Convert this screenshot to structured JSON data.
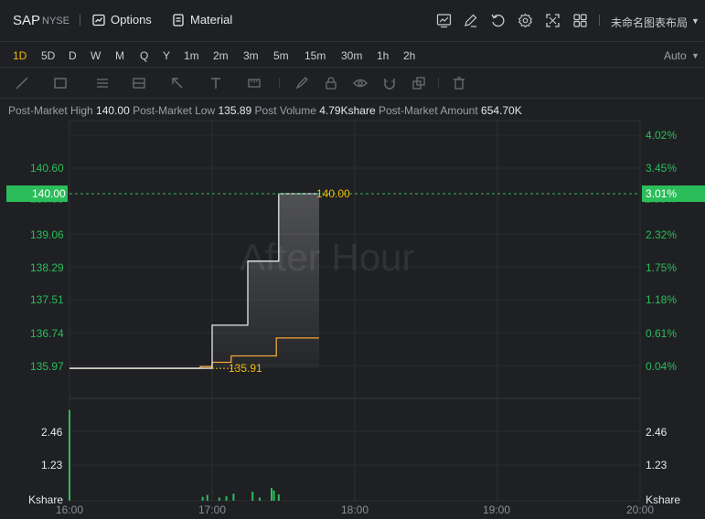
{
  "header": {
    "symbol": "SAP",
    "exchange": "NYSE",
    "options_label": "Options",
    "material_label": "Material",
    "layout_name": "未命名图表布局",
    "icons": [
      "chart-icon",
      "pen-icon",
      "undo-icon",
      "gear-icon",
      "fullscreen-icon",
      "grid-layout-icon"
    ]
  },
  "intervals": {
    "items": [
      "1D",
      "5D",
      "D",
      "W",
      "M",
      "Q",
      "Y",
      "1m",
      "2m",
      "3m",
      "5m",
      "15m",
      "30m",
      "1h",
      "2h"
    ],
    "active": "1D",
    "scale_mode": "Auto"
  },
  "drawing_tools": [
    "line-tool-icon",
    "rectangle-tool-icon",
    "fib-tool-icon",
    "arrow-tool-icon",
    "text-tool-icon",
    "measure-tool-icon",
    "brush-icon",
    "lock-icon",
    "eye-icon",
    "magnet-icon",
    "clone-icon",
    "trash-icon"
  ],
  "info": {
    "high_label": "Post-Market High",
    "high_value": "140.00",
    "low_label": "Post-Market Low",
    "low_value": "135.89",
    "volume_label": "Post Volume",
    "volume_value": "4.79Kshare",
    "amount_label": "Post-Market Amount",
    "amount_value": "654.70K"
  },
  "watermark": "After Hour",
  "price_axis": {
    "labels": [
      "140.60",
      "139.06",
      "138.29",
      "137.51",
      "136.74",
      "135.97"
    ],
    "current_price": "140.00",
    "hidden_label": "139.83"
  },
  "percent_axis": {
    "labels": [
      "4.02%",
      "3.45%",
      "2.32%",
      "1.75%",
      "1.18%",
      "0.61%",
      "0.04%"
    ],
    "current_pct": "3.01%",
    "hidden_label": "2.88%"
  },
  "volume_axis": {
    "labels": [
      "2.46",
      "1.23"
    ],
    "unit": "Kshare"
  },
  "time_axis": [
    "16:00",
    "17:00",
    "18:00",
    "19:00",
    "20:00"
  ],
  "markers": {
    "last": "140.00",
    "low": "135.91"
  },
  "colors": {
    "up": "#2bbd5a",
    "avg_line": "#f0a73b",
    "price_line": "#e6e8eb",
    "accent": "#f0b90b"
  },
  "chart_data": {
    "type": "line",
    "x_range": [
      "16:00",
      "20:00"
    ],
    "ylim": [
      135.89,
      140.6
    ],
    "series": [
      {
        "x": [
          "16:00",
          "16:55",
          "16:59",
          "17:00",
          "17:10",
          "17:15",
          "17:25",
          "17:28",
          "17:45"
        ],
        "values": [
          135.91,
          135.91,
          135.91,
          136.92,
          136.92,
          138.42,
          138.42,
          140.0,
          140.0
        ]
      },
      {
        "x": [
          "16:00",
          "16:55",
          "17:00",
          "17:08",
          "17:25",
          "17:27",
          "17:45"
        ],
        "values": [
          135.91,
          135.95,
          136.05,
          136.2,
          136.2,
          136.62,
          136.62
        ]
      }
    ],
    "volume": {
      "x": [
        "16:00",
        "16:56",
        "16:58",
        "17:03",
        "17:06",
        "17:09",
        "17:17",
        "17:20",
        "17:25",
        "17:26",
        "17:28"
      ],
      "values": [
        2.85,
        0.12,
        0.18,
        0.1,
        0.14,
        0.22,
        0.28,
        0.1,
        0.4,
        0.32,
        0.2
      ]
    }
  }
}
